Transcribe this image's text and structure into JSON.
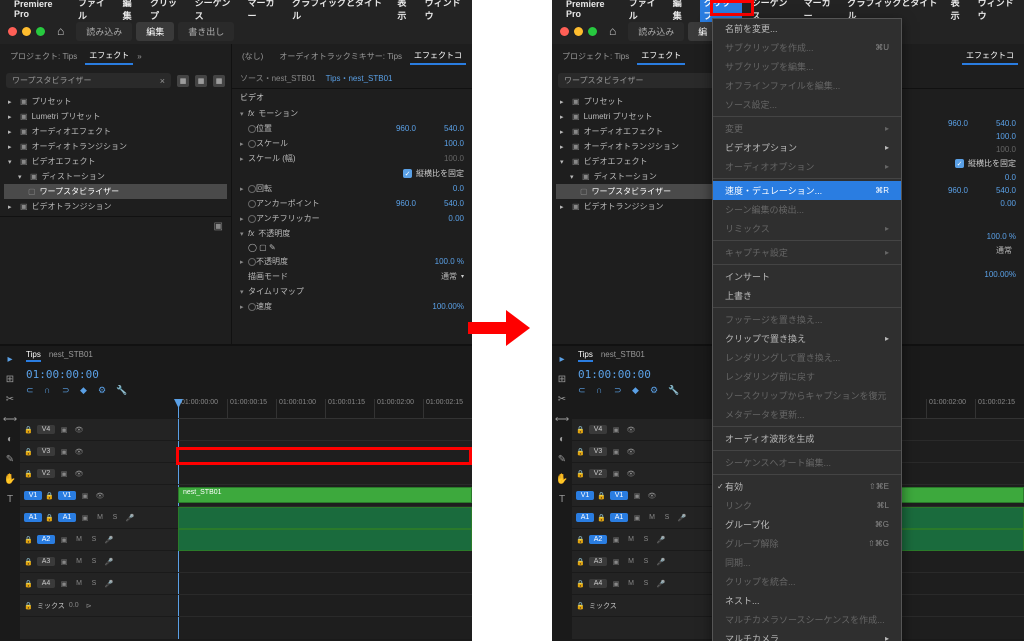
{
  "app_name": "Premiere Pro",
  "menubar": [
    "ファイル",
    "編集",
    "クリップ",
    "シーケンス",
    "マーカー",
    "グラフィックとタイトル",
    "表示",
    "ウィンドウ"
  ],
  "toolbar": {
    "tab1": "読み込み",
    "tab2": "編集",
    "tab3": "書き出し"
  },
  "tabs_left": {
    "project": "プロジェクト: Tips",
    "effects": "エフェクト"
  },
  "search_value": "ワープスタビライザー",
  "tree": [
    {
      "label": "プリセット",
      "indent": 0
    },
    {
      "label": "Lumetri プリセット",
      "indent": 0
    },
    {
      "label": "オーディオエフェクト",
      "indent": 0
    },
    {
      "label": "オーディオトランジション",
      "indent": 0
    },
    {
      "label": "ビデオエフェクト",
      "indent": 0,
      "open": true
    },
    {
      "label": "ディストーション",
      "indent": 1,
      "open": true
    },
    {
      "label": "ワープスタビライザー",
      "indent": 2,
      "selected": true
    },
    {
      "label": "ビデオトランジション",
      "indent": 0
    }
  ],
  "ec_header": {
    "src": "ソース・nest_STB01",
    "clip": "Tips・nest_STB01"
  },
  "ec_tabs_right": {
    "none": "(なし)",
    "mixer": "オーディオトラックミキサー: Tips",
    "ec": "エフェクトコ"
  },
  "ec_section_video": "ビデオ",
  "effects": {
    "motion": "モーション",
    "position": "位置",
    "position_x": "960.0",
    "position_y": "540.0",
    "scale": "スケール",
    "scale_v": "100.0",
    "scale_w": "スケール (幅)",
    "scale_w_v": "100.0",
    "uniform": "縦横比を固定",
    "rotation": "回転",
    "rotation_v": "0.0",
    "anchor": "アンカーポイント",
    "anchor_x": "960.0",
    "anchor_y": "540.0",
    "antiflicker": "アンチフリッカー",
    "antiflicker_v": "0.00",
    "opacity": "不透明度",
    "opacity_prop": "不透明度",
    "opacity_v": "100.0 %",
    "blend": "描画モード",
    "blend_v": "通常",
    "timeremap": "タイムリマップ",
    "speed": "速度",
    "speed_v": "100.00%"
  },
  "footer_tc": "01:00:00:00",
  "timeline": {
    "tabs": [
      "Tips",
      "nest_STB01"
    ],
    "timecode": "01:00:00:00",
    "ruler": [
      "01:00:00:00",
      "01:00:00:15",
      "01:00:01:00",
      "01:00:01:15",
      "01:00:02:00",
      "01:00:02:15"
    ],
    "tracks_v": [
      "V4",
      "V3",
      "V2",
      "V1"
    ],
    "tracks_a": [
      "A1",
      "A2",
      "A3",
      "A4"
    ],
    "mix": "ミックス",
    "clip_name": "nest_STB01"
  },
  "menu": {
    "rename": "名前を変更...",
    "make_subclip": "サブクリップを作成...",
    "make_subclip_sc": "⌘U",
    "edit_subclip": "サブクリップを編集...",
    "edit_offline": "オフラインファイルを編集...",
    "source_settings": "ソース設定...",
    "modify": "変更",
    "video_options": "ビデオオプション",
    "audio_options": "オーディオオプション",
    "speed_duration": "速度・デュレーション...",
    "speed_duration_sc": "⌘R",
    "scene_edit": "シーン編集の検出...",
    "remix": "リミックス",
    "capture": "キャプチャ設定",
    "insert": "インサート",
    "overwrite": "上書き",
    "replace_footage": "フッテージを置き換え...",
    "replace_clip": "クリップで置き換え",
    "render_replace": "レンダリングして置き換え...",
    "restore_unrendered": "レンダリング前に戻す",
    "restore_captions": "ソースクリップからキャプションを復元",
    "update_metadata": "メタデータを更新...",
    "gen_audio_wave": "オーディオ波形を生成",
    "automate": "シーケンスへオート編集...",
    "enable": "有効",
    "enable_sc": "⇧⌘E",
    "link": "リンク",
    "link_sc": "⌘L",
    "group": "グループ化",
    "group_sc": "⌘G",
    "ungroup": "グループ解除",
    "ungroup_sc": "⇧⌘G",
    "sync": "同期...",
    "merge": "クリップを統合...",
    "nest": "ネスト...",
    "multicam_seq": "マルチカメラソースシーケンスを作成...",
    "multicam": "マルチカメラ"
  }
}
